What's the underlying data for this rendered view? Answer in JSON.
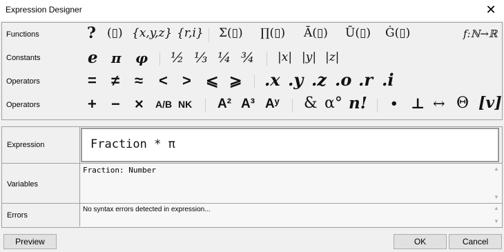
{
  "window": {
    "title": "Expression Designer",
    "close_glyph": "✕"
  },
  "palette": {
    "rows": [
      {
        "label": "Functions"
      },
      {
        "label": "Constants"
      },
      {
        "label": "Operators"
      },
      {
        "label": "Operators"
      }
    ],
    "functions": {
      "query": "?",
      "paren": "(▯)",
      "set_xyz": "{x,y,z}",
      "set_ri": "{r,i}",
      "sum": "Σ(▯)",
      "product": "∏(▯)",
      "mean": "Ā(▯)",
      "mean_u": "Ū(▯)",
      "g_dot": "Ġ(▯)",
      "map": "f:ℕ→ℝ"
    },
    "constants": {
      "e": "e",
      "pi": "π",
      "phi": "φ",
      "half": "½",
      "third": "⅓",
      "quarter": "¼",
      "three_quarters": "¾",
      "abs_x": "|x|",
      "abs_y": "|y|",
      "abs_z": "|z|"
    },
    "comparisons": {
      "eq": "=",
      "neq": "≠",
      "approx": "≈",
      "lt": "<",
      "gt": ">",
      "le": "⩽",
      "ge": "⩾",
      "dot_x": ".x",
      "dot_y": ".y",
      "dot_z": ".z",
      "dot_o": ".o",
      "dot_r": ".r",
      "dot_i": ".i"
    },
    "arithmetic": {
      "plus": "+",
      "minus": "−",
      "times": "×",
      "divide": "A/B",
      "nck": "NK",
      "square": "A²",
      "cube": "A³",
      "power": "Aʸ",
      "and": "&",
      "degree": "α°",
      "factorial": "n!",
      "dot": "•",
      "perp": "⊥",
      "arrow": "↔",
      "theta": "Θ",
      "vector": "[v]"
    }
  },
  "expression": {
    "label": "Expression",
    "value": "Fraction * π"
  },
  "variables": {
    "label": "Variables",
    "value": "Fraction: Number"
  },
  "errors": {
    "label": "Errors",
    "value": "No syntax errors detected in expression..."
  },
  "buttons": {
    "preview": "Preview",
    "ok": "OK",
    "cancel": "Cancel"
  },
  "scrollbar": {
    "up_glyph": "▲",
    "down_glyph": "▼"
  }
}
